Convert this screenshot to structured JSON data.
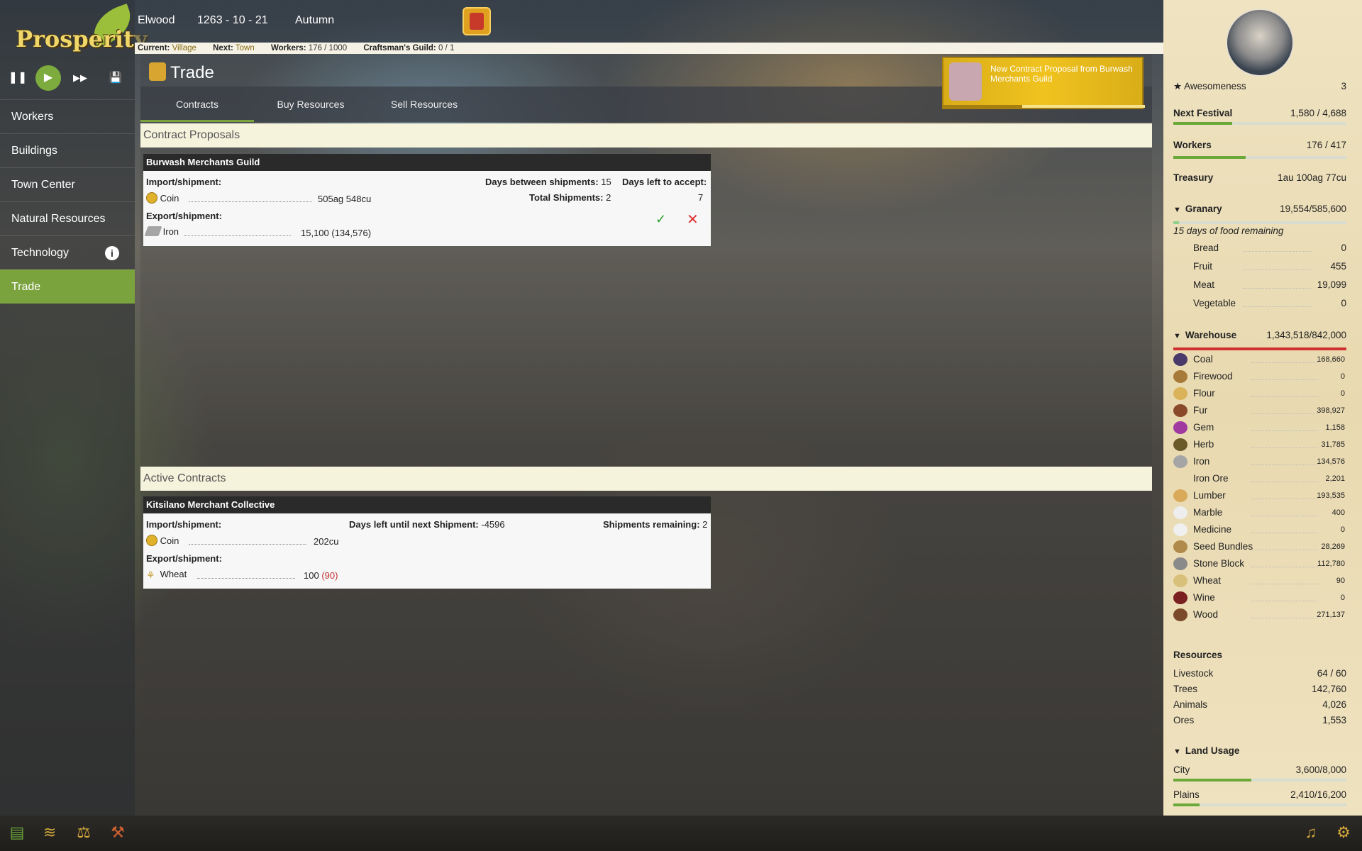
{
  "app": {
    "logo": "Prosperity"
  },
  "controls": {
    "pause": "❚❚",
    "play": "▶",
    "fast": "▶▶",
    "save": "💾"
  },
  "nav": {
    "items": [
      "Workers",
      "Buildings",
      "Town Center",
      "Natural Resources",
      "Technology",
      "Trade"
    ],
    "active": "Trade",
    "info_icon": "i"
  },
  "topbar": {
    "town": "Elwood",
    "date": "1263 - 10 - 21",
    "season": "Autumn"
  },
  "status": {
    "current_label": "Current:",
    "current": "Village",
    "next_label": "Next:",
    "next": "Town",
    "workers_label": "Workers:",
    "workers": "176 / 1000",
    "guild_label": "Craftsman's Guild:",
    "guild": "0 / 1"
  },
  "page": {
    "title": "Trade",
    "tabs": [
      "Contracts",
      "Buy Resources",
      "Sell Resources"
    ],
    "active_tab": "Contracts"
  },
  "notification": {
    "text": "New Contract Proposal from Burwash Merchants Guild",
    "progress": 0.39
  },
  "proposals": {
    "section_title": "Contract Proposals",
    "card": {
      "name": "Burwash Merchants Guild",
      "import_label": "Import/shipment:",
      "import_item": "Coin",
      "import_amount": "505ag 548cu",
      "export_label": "Export/shipment:",
      "export_item": "Iron",
      "export_amount": "15,100 (134,576)",
      "days_between_label": "Days between shipments:",
      "days_between": "15",
      "total_label": "Total Shipments:",
      "total": "2",
      "days_left_label": "Days left to accept:",
      "days_left": "7",
      "accept": "✓",
      "reject": "✕"
    }
  },
  "active": {
    "section_title": "Active Contracts",
    "card": {
      "name": "Kitsilano Merchant Collective",
      "import_label": "Import/shipment:",
      "import_item": "Coin",
      "import_amount": "202cu",
      "export_label": "Export/shipment:",
      "export_item": "Wheat",
      "export_amount": "100",
      "export_have": "(90)",
      "next_label": "Days left until next Shipment:",
      "next": "-4596",
      "remaining_label": "Shipments remaining:",
      "remaining": "2"
    }
  },
  "sidebar": {
    "awesomeness_label": "Awesomeness",
    "awesomeness": "3",
    "festival_label": "Next Festival",
    "festival": "1,580 / 4,688",
    "festival_progress": 0.34,
    "workers_label": "Workers",
    "workers": "176 / 417",
    "workers_progress": 0.42,
    "treasury_label": "Treasury",
    "treasury": "1au 100ag 77cu",
    "granary_label": "Granary",
    "granary": "19,554/585,600",
    "granary_progress": 0.033,
    "food_note": "15 days of food remaining",
    "food": [
      {
        "name": "Bread",
        "value": "0"
      },
      {
        "name": "Fruit",
        "value": "455"
      },
      {
        "name": "Meat",
        "value": "19,099"
      },
      {
        "name": "Vegetable",
        "value": "0"
      }
    ],
    "warehouse_label": "Warehouse",
    "warehouse": "1,343,518/842,000",
    "warehouse_progress": 1.0,
    "warehouse_items": [
      {
        "name": "Coal",
        "value": "168,660",
        "color": "#4a3a6a"
      },
      {
        "name": "Firewood",
        "value": "0",
        "color": "#a87a3a"
      },
      {
        "name": "Flour",
        "value": "0",
        "color": "#d9b25a"
      },
      {
        "name": "Fur",
        "value": "398,927",
        "color": "#8a4a2a"
      },
      {
        "name": "Gem",
        "value": "1,158",
        "color": "#a03aa0"
      },
      {
        "name": "Herb",
        "value": "31,785",
        "color": "#6a5a2a"
      },
      {
        "name": "Iron",
        "value": "134,576",
        "color": "#a5a5a5"
      },
      {
        "name": "Iron Ore",
        "value": "2,201",
        "color": "transparent"
      },
      {
        "name": "Lumber",
        "value": "193,535",
        "color": "#d9aa5a"
      },
      {
        "name": "Marble",
        "value": "400",
        "color": "#eeeeee"
      },
      {
        "name": "Medicine",
        "value": "0",
        "color": "#f0f0f0"
      },
      {
        "name": "Seed Bundles",
        "value": "28,269",
        "color": "#b08a4a"
      },
      {
        "name": "Stone Block",
        "value": "112,780",
        "color": "#8a8a8a"
      },
      {
        "name": "Wheat",
        "value": "90",
        "color": "#d9c07a"
      },
      {
        "name": "Wine",
        "value": "0",
        "color": "#7a2020"
      },
      {
        "name": "Wood",
        "value": "271,137",
        "color": "#7a4a2a"
      }
    ],
    "resources_label": "Resources",
    "resources": [
      {
        "name": "Livestock",
        "value": "64 / 60"
      },
      {
        "name": "Trees",
        "value": "142,760"
      },
      {
        "name": "Animals",
        "value": "4,026"
      },
      {
        "name": "Ores",
        "value": "1,553"
      }
    ],
    "land_label": "Land Usage",
    "land": [
      {
        "name": "City",
        "value": "3,600/8,000",
        "progress": 0.45
      },
      {
        "name": "Plains",
        "value": "2,410/16,200",
        "progress": 0.15
      }
    ]
  }
}
